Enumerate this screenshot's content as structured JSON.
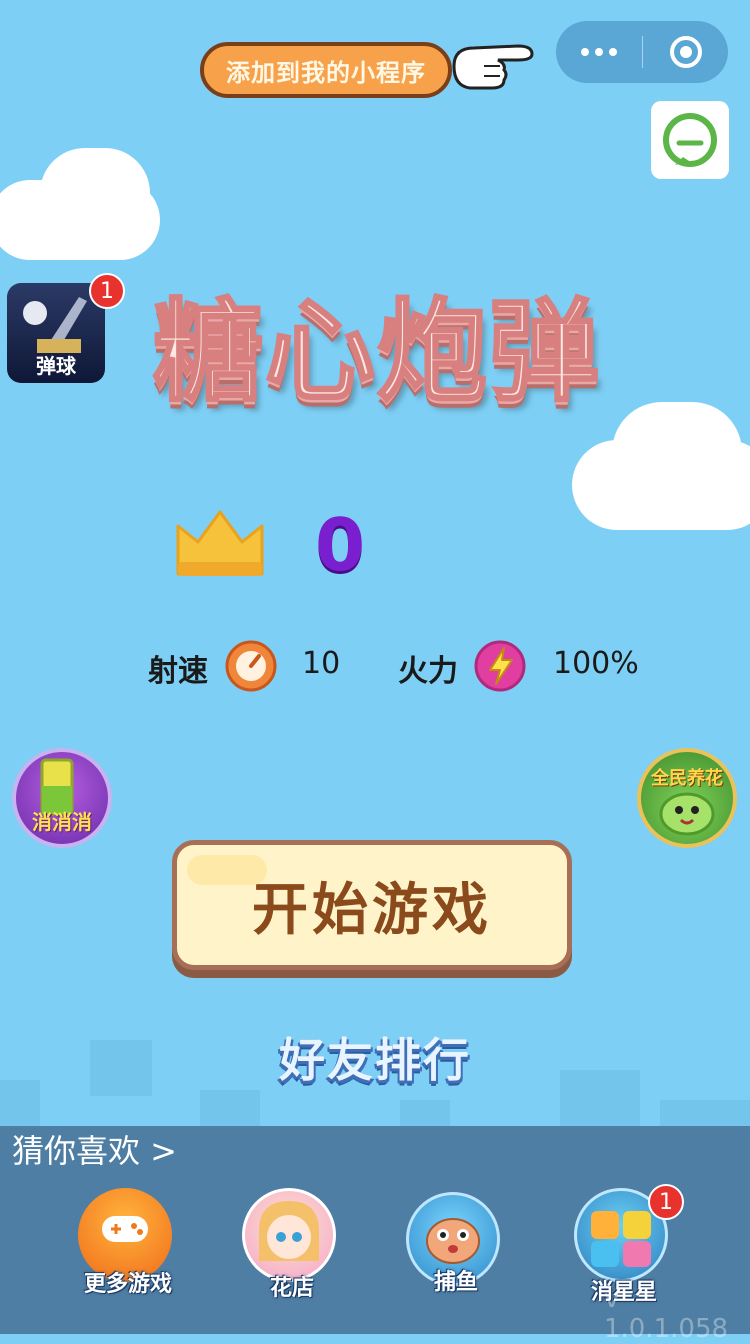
{
  "top_bar": {
    "add_to_mini_program": "添加到我的小程序",
    "menu_icon": "more-dots-icon",
    "close_icon": "target-icon",
    "chat_icon": "chat-bubble-icon"
  },
  "app_icon": {
    "label": "弹球",
    "badge": "1"
  },
  "title": "糖心炮弹",
  "score": {
    "icon": "crown-icon",
    "value": "0"
  },
  "stats": {
    "speed_label": "射速",
    "speed_icon": "gauge-icon",
    "speed_value": "10",
    "fire_label": "火力",
    "fire_icon": "lightning-icon",
    "fire_value": "100%"
  },
  "side_games": {
    "left_label": "消消消",
    "right_label": "全民养花"
  },
  "start_button": "开始游戏",
  "rank_button": "好友排行",
  "recommend": {
    "title": "猜你喜欢 >",
    "items": [
      {
        "label": "更多游戏",
        "icon": "gamepad-icon",
        "badge": ""
      },
      {
        "label": "花店",
        "icon": "girl-avatar-icon",
        "badge": ""
      },
      {
        "label": "捕鱼",
        "icon": "pufferfish-icon",
        "badge": ""
      },
      {
        "label": "消星星",
        "icon": "star-blocks-icon",
        "badge": "1"
      }
    ]
  },
  "version": "v 1.0.1.058",
  "colors": {
    "sky": "#7ecff5",
    "title_fill": "#fde7e3",
    "score": "#7a1fd0",
    "start_button": "#fff4c9",
    "badge": "#e8322e"
  }
}
